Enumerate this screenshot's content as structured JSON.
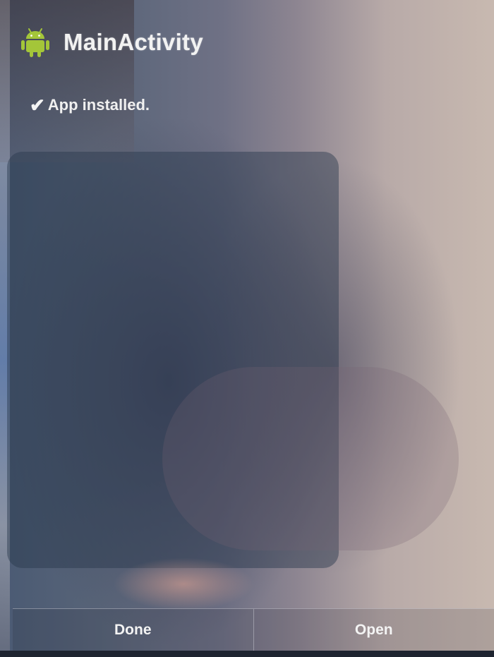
{
  "dialog": {
    "title": "MainActivity",
    "icon": "android-icon",
    "status": {
      "icon": "check-icon",
      "text": "App installed."
    },
    "buttons": {
      "done_label": "Done",
      "open_label": "Open"
    }
  },
  "colors": {
    "android_green": "#a4c639",
    "text": "#f2f2f2",
    "divider": "#d2d2dc"
  }
}
